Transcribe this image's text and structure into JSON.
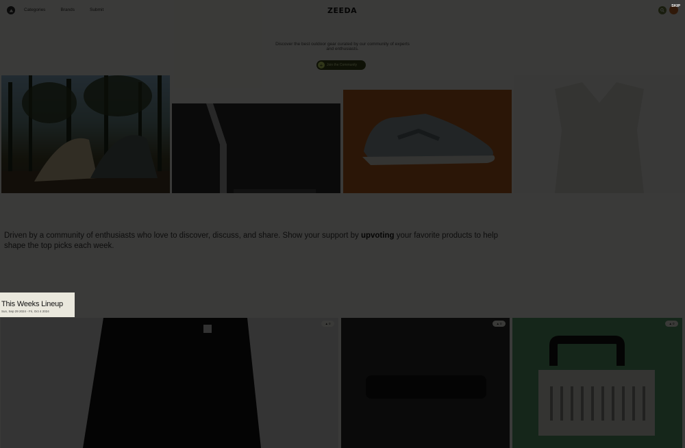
{
  "header": {
    "brand": "ZEEDA",
    "nav": [
      "Categories",
      "Brands",
      "Submit"
    ],
    "skip_label": "SKIP"
  },
  "hero": {
    "subtitle": "Discover the best outdoor gear curated by our community of experts and enthusiasts.",
    "cta_label": "Join the Community"
  },
  "gallery": [
    {
      "name": "tent"
    },
    {
      "name": "poles"
    },
    {
      "name": "sneaker"
    },
    {
      "name": "vest"
    }
  ],
  "tagline": {
    "before": "Driven by a community of enthusiasts who love to discover, discuss, and share. Show your support by ",
    "bold": "upvoting",
    "after": " your favorite products to help shape the top picks each week."
  },
  "lineup": {
    "title": "This Weeks Lineup",
    "dates": "Sun, Sep 29 2024 - Fri, Oct 4 2024"
  },
  "products": [
    {
      "name": "jacket",
      "votes": "0"
    },
    {
      "name": "bag",
      "votes": "0"
    },
    {
      "name": "power-box",
      "votes": "0"
    }
  ],
  "colors": {
    "accent": "#c8e26a",
    "brand_dark": "#3c4a1c",
    "overlay": "#000000"
  }
}
